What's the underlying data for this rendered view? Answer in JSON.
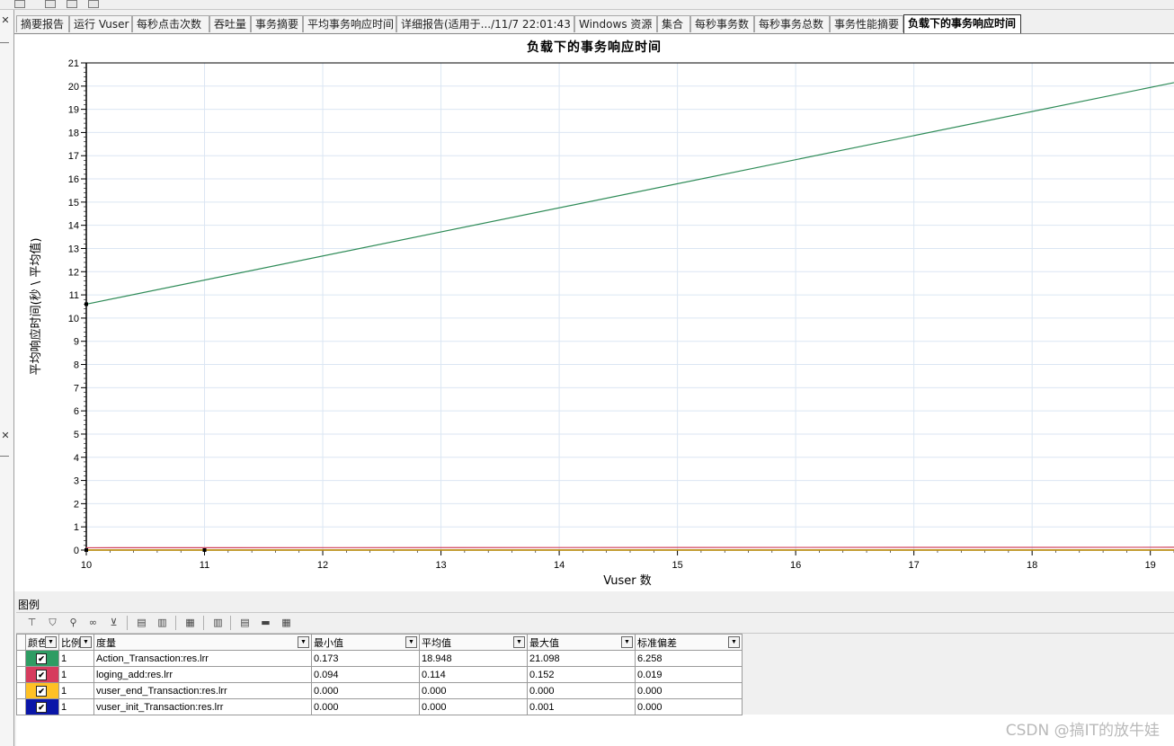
{
  "tabs": [
    {
      "label": "摘要报告",
      "active": false
    },
    {
      "label": "运行 Vuser",
      "active": false
    },
    {
      "label": "每秒点击次数",
      "active": false
    },
    {
      "label": "吞吐量",
      "active": false
    },
    {
      "label": "事务摘要",
      "active": false
    },
    {
      "label": "平均事务响应时间",
      "active": false
    },
    {
      "label": "详细报告(适用于.../11/7 22:01:43",
      "active": false
    },
    {
      "label": "Windows 资源",
      "active": false
    },
    {
      "label": "集合",
      "active": false
    },
    {
      "label": "每秒事务数",
      "active": false
    },
    {
      "label": "每秒事务总数",
      "active": false
    },
    {
      "label": "事务性能摘要",
      "active": false
    },
    {
      "label": "负载下的事务响应时间",
      "active": true
    }
  ],
  "chart_data": {
    "type": "line",
    "title": "负载下的事务响应时间",
    "xlabel": "Vuser 数",
    "ylabel": "平均响应时间(秒 \\ 平均值)",
    "xlim": [
      10,
      19.2
    ],
    "ylim": [
      0,
      21
    ],
    "x_ticks": [
      10,
      11,
      12,
      13,
      14,
      15,
      16,
      17,
      18,
      19
    ],
    "y_ticks": [
      0,
      1,
      2,
      3,
      4,
      5,
      6,
      7,
      8,
      9,
      10,
      11,
      12,
      13,
      14,
      15,
      16,
      17,
      18,
      19,
      20,
      21
    ],
    "grid": true,
    "series": [
      {
        "name": "Action_Transaction:res.lrr",
        "color": "#2e8b57",
        "x": [
          10,
          19.2
        ],
        "y": [
          10.6,
          20.15
        ]
      },
      {
        "name": "loging_add:res.lrr",
        "color": "#d0405a",
        "x": [
          10,
          19.2
        ],
        "y": [
          0.1,
          0.12
        ]
      },
      {
        "name": "vuser_end_Transaction:res.lrr",
        "color": "#ffc000",
        "x": [
          10,
          19.2
        ],
        "y": [
          0,
          0
        ]
      },
      {
        "name": "vuser_init_Transaction:res.lrr",
        "color": "#00008b",
        "x": [
          10,
          19.2
        ],
        "y": [
          0,
          0
        ]
      }
    ],
    "markers": [
      {
        "x": 10,
        "y": 10.6
      },
      {
        "x": 10,
        "y": 0
      },
      {
        "x": 11,
        "y": 0
      }
    ]
  },
  "legend": {
    "label": "图例",
    "toolbar_icons": [
      "legend-config-icon",
      "filter-icon",
      "link-icon",
      "binoculars-icon",
      "funnel-icon",
      "highlight-icon",
      "hide-icon",
      "report-icon",
      "columns-icon",
      "merge-icon",
      "ruler-icon",
      "properties-icon"
    ],
    "columns": [
      {
        "label": "",
        "dropdown": false
      },
      {
        "label": "颜色",
        "dropdown": true
      },
      {
        "label": "比例",
        "dropdown": true
      },
      {
        "label": "度量",
        "dropdown": true
      },
      {
        "label": "最小值",
        "dropdown": true
      },
      {
        "label": "平均值",
        "dropdown": true
      },
      {
        "label": "最大值",
        "dropdown": true
      },
      {
        "label": "标准偏差",
        "dropdown": true
      }
    ],
    "rows": [
      {
        "color": "#2e9c63",
        "checked": true,
        "scale": "1",
        "measure": "Action_Transaction:res.lrr",
        "min": "0.173",
        "avg": "18.948",
        "max": "21.098",
        "std": "6.258"
      },
      {
        "color": "#d63c5e",
        "checked": true,
        "scale": "1",
        "measure": "loging_add:res.lrr",
        "min": "0.094",
        "avg": "0.114",
        "max": "0.152",
        "std": "0.019"
      },
      {
        "color": "#ffc125",
        "checked": true,
        "scale": "1",
        "measure": "vuser_end_Transaction:res.lrr",
        "min": "0.000",
        "avg": "0.000",
        "max": "0.000",
        "std": "0.000"
      },
      {
        "color": "#0a16a8",
        "checked": true,
        "scale": "1",
        "measure": "vuser_init_Transaction:res.lrr",
        "min": "0.000",
        "avg": "0.000",
        "max": "0.001",
        "std": "0.000"
      }
    ]
  },
  "left_panel": {
    "close_glyph": "✕"
  },
  "watermark": "CSDN @搞IT的放牛娃"
}
